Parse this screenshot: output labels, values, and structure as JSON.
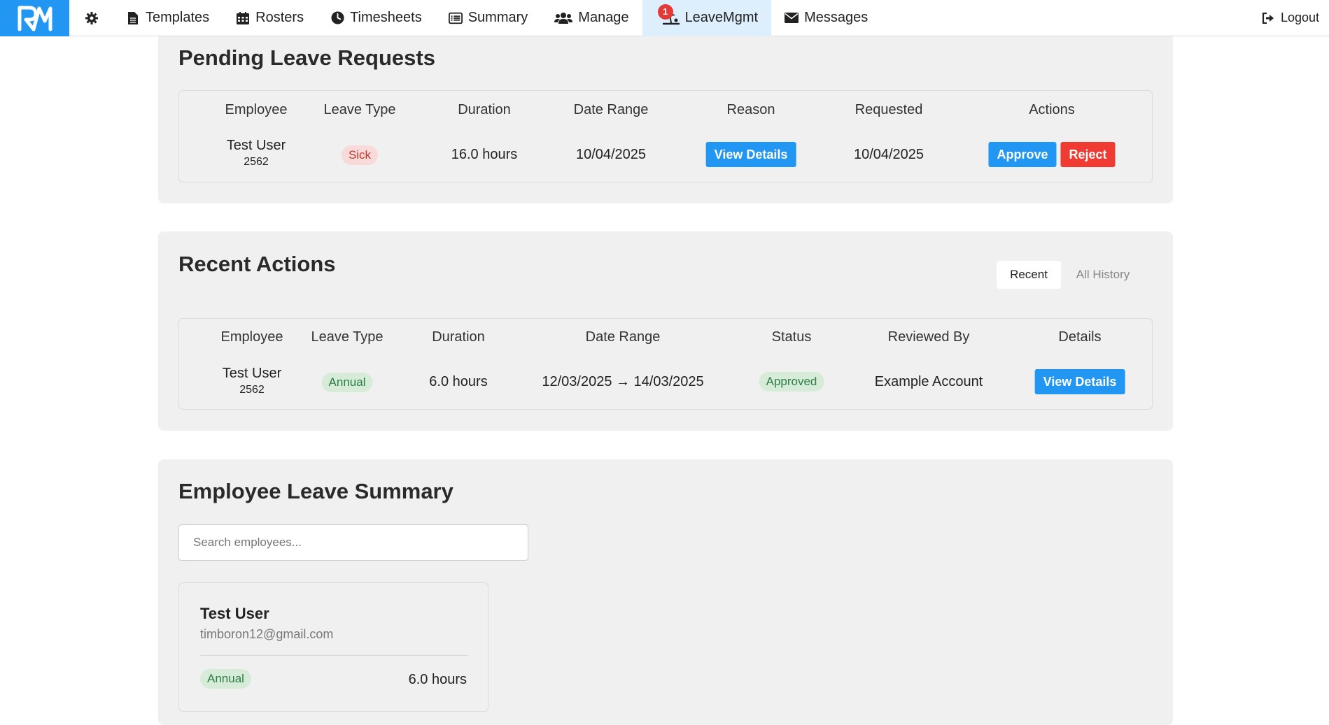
{
  "nav": {
    "items": [
      {
        "label": "Templates",
        "icon": "file-icon"
      },
      {
        "label": "Rosters",
        "icon": "calendar-icon"
      },
      {
        "label": "Timesheets",
        "icon": "clock-icon"
      },
      {
        "label": "Summary",
        "icon": "list-icon"
      },
      {
        "label": "Manage",
        "icon": "users-icon"
      },
      {
        "label": "LeaveMgmt",
        "icon": "beach-icon",
        "badge": "1"
      },
      {
        "label": "Messages",
        "icon": "envelope-icon"
      }
    ],
    "logout": "Logout",
    "accent": "#2196f3"
  },
  "pending": {
    "title": "Pending Leave Requests",
    "headers": [
      "Employee",
      "Leave Type",
      "Duration",
      "Date Range",
      "Reason",
      "Requested",
      "Actions"
    ],
    "rows": [
      {
        "name": "Test User",
        "id": "2562",
        "type": "Sick",
        "duration": "16.0 hours",
        "date_range": "10/04/2025",
        "reason_btn": "View Details",
        "requested": "10/04/2025",
        "approve": "Approve",
        "reject": "Reject"
      }
    ]
  },
  "recent": {
    "title": "Recent Actions",
    "tabs": {
      "recent": "Recent",
      "history": "All History"
    },
    "headers": [
      "Employee",
      "Leave Type",
      "Duration",
      "Date Range",
      "Status",
      "Reviewed By",
      "Details"
    ],
    "rows": [
      {
        "name": "Test User",
        "id": "2562",
        "type": "Annual",
        "duration": "6.0 hours",
        "date_range": "12/03/2025 → 14/03/2025",
        "status": "Approved",
        "reviewed_by": "Example Account",
        "details_btn": "View Details"
      }
    ]
  },
  "summary": {
    "title": "Employee Leave Summary",
    "search_placeholder": "Search employees...",
    "cards": [
      {
        "name": "Test User",
        "email": "timboron12@gmail.com",
        "type": "Annual",
        "hours": "6.0 hours"
      }
    ]
  }
}
